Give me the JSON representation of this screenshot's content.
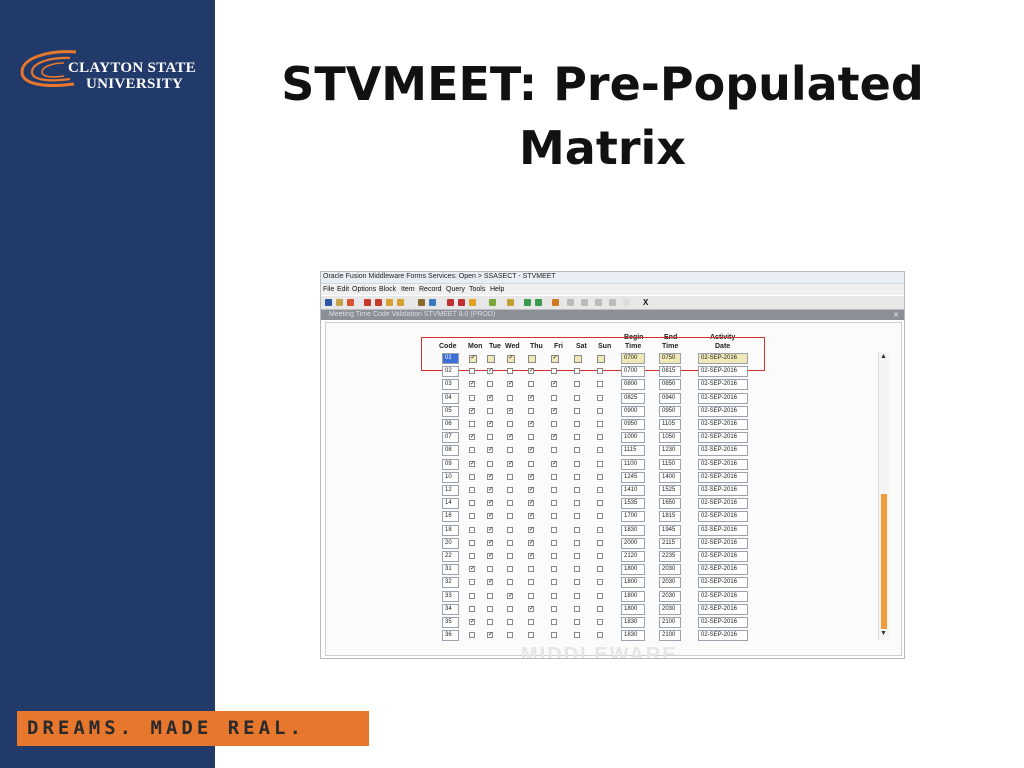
{
  "brand": {
    "line1": "CLAYTON STATE",
    "line2": "UNIVERSITY",
    "tagline": "DREAMS. MADE REAL."
  },
  "slide": {
    "title_line1": "STVMEET: Pre-Populated",
    "title_line2": "Matrix"
  },
  "app": {
    "window_title": "Oracle Fusion Middleware Forms Services:  Open > SSASECT - STVMEET",
    "menu": [
      "File",
      "Edit",
      "Options",
      "Block",
      "Item",
      "Record",
      "Query",
      "Tools",
      "Help"
    ],
    "form_title": "Meeting Time Code Validation  STVMEET  8.0  (PROD)",
    "toolbar_x": "X",
    "watermark": "MIDDLEWARE"
  },
  "table": {
    "headers": {
      "code": "Code",
      "mon": "Mon",
      "tue": "Tue",
      "wed": "Wed",
      "thu": "Thu",
      "fri": "Fri",
      "sat": "Sat",
      "sun": "Sun",
      "begin1": "Begin",
      "begin2": "Time",
      "end1": "End",
      "end2": "Time",
      "act1": "Activity",
      "act2": "Date"
    },
    "rows": [
      {
        "code": "01",
        "days": [
          1,
          0,
          1,
          0,
          1,
          0,
          0
        ],
        "begin": "0700",
        "end": "0750",
        "date": "02-SEP-2016"
      },
      {
        "code": "02",
        "days": [
          0,
          1,
          0,
          1,
          0,
          0,
          0
        ],
        "begin": "0700",
        "end": "0815",
        "date": "02-SEP-2016"
      },
      {
        "code": "03",
        "days": [
          1,
          0,
          1,
          0,
          1,
          0,
          0
        ],
        "begin": "0800",
        "end": "0850",
        "date": "02-SEP-2016"
      },
      {
        "code": "04",
        "days": [
          0,
          1,
          0,
          1,
          0,
          0,
          0
        ],
        "begin": "0825",
        "end": "0940",
        "date": "02-SEP-2016"
      },
      {
        "code": "05",
        "days": [
          1,
          0,
          1,
          0,
          1,
          0,
          0
        ],
        "begin": "0900",
        "end": "0950",
        "date": "02-SEP-2016"
      },
      {
        "code": "06",
        "days": [
          0,
          1,
          0,
          1,
          0,
          0,
          0
        ],
        "begin": "0950",
        "end": "1105",
        "date": "02-SEP-2016"
      },
      {
        "code": "07",
        "days": [
          1,
          0,
          1,
          0,
          1,
          0,
          0
        ],
        "begin": "1000",
        "end": "1050",
        "date": "02-SEP-2016"
      },
      {
        "code": "08",
        "days": [
          0,
          1,
          0,
          1,
          0,
          0,
          0
        ],
        "begin": "1115",
        "end": "1230",
        "date": "02-SEP-2016"
      },
      {
        "code": "09",
        "days": [
          1,
          0,
          1,
          0,
          1,
          0,
          0
        ],
        "begin": "1100",
        "end": "1150",
        "date": "02-SEP-2016"
      },
      {
        "code": "10",
        "days": [
          0,
          1,
          0,
          1,
          0,
          0,
          0
        ],
        "begin": "1245",
        "end": "1400",
        "date": "02-SEP-2016"
      },
      {
        "code": "12",
        "days": [
          0,
          1,
          0,
          1,
          0,
          0,
          0
        ],
        "begin": "1410",
        "end": "1525",
        "date": "02-SEP-2016"
      },
      {
        "code": "14",
        "days": [
          0,
          1,
          0,
          1,
          0,
          0,
          0
        ],
        "begin": "1535",
        "end": "1650",
        "date": "02-SEP-2016"
      },
      {
        "code": "16",
        "days": [
          0,
          1,
          0,
          1,
          0,
          0,
          0
        ],
        "begin": "1700",
        "end": "1815",
        "date": "02-SEP-2016"
      },
      {
        "code": "18",
        "days": [
          0,
          1,
          0,
          1,
          0,
          0,
          0
        ],
        "begin": "1830",
        "end": "1945",
        "date": "02-SEP-2016"
      },
      {
        "code": "20",
        "days": [
          0,
          1,
          0,
          1,
          0,
          0,
          0
        ],
        "begin": "2000",
        "end": "2115",
        "date": "02-SEP-2016"
      },
      {
        "code": "22",
        "days": [
          0,
          1,
          0,
          1,
          0,
          0,
          0
        ],
        "begin": "2120",
        "end": "2235",
        "date": "02-SEP-2016"
      },
      {
        "code": "31",
        "days": [
          1,
          0,
          0,
          0,
          0,
          0,
          0
        ],
        "begin": "1800",
        "end": "2030",
        "date": "02-SEP-2016"
      },
      {
        "code": "32",
        "days": [
          0,
          1,
          0,
          0,
          0,
          0,
          0
        ],
        "begin": "1800",
        "end": "2030",
        "date": "02-SEP-2016"
      },
      {
        "code": "33",
        "days": [
          0,
          0,
          1,
          0,
          0,
          0,
          0
        ],
        "begin": "1800",
        "end": "2030",
        "date": "02-SEP-2016"
      },
      {
        "code": "34",
        "days": [
          0,
          0,
          0,
          1,
          0,
          0,
          0
        ],
        "begin": "1800",
        "end": "2030",
        "date": "02-SEP-2016"
      },
      {
        "code": "35",
        "days": [
          1,
          0,
          0,
          0,
          0,
          0,
          0
        ],
        "begin": "1830",
        "end": "2100",
        "date": "02-SEP-2016"
      },
      {
        "code": "36",
        "days": [
          0,
          1,
          0,
          0,
          0,
          0,
          0
        ],
        "begin": "1830",
        "end": "2100",
        "date": "02-SEP-2016"
      }
    ]
  },
  "colors": {
    "sidebar": "#223a6a",
    "accent": "#e8772e",
    "highlight": "#d32f2f",
    "scroll_thumb": "#f39b3a"
  }
}
